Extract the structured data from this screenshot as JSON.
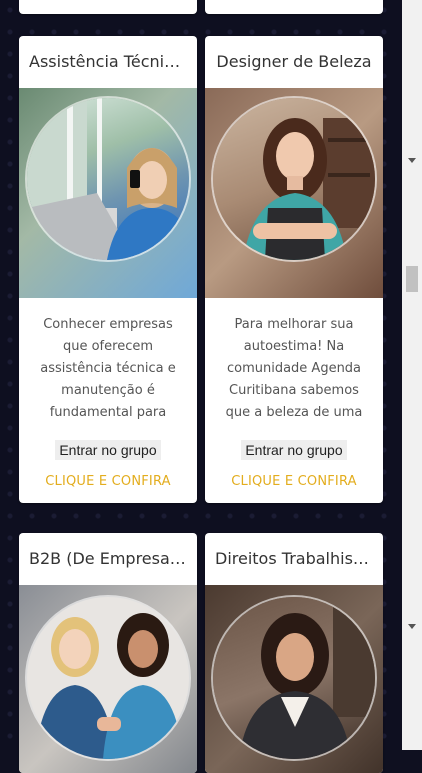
{
  "cards": [
    {
      "title": "Assistência Técnic...",
      "description": "Conhecer empresas que oferecem assistência técnica e manutenção é fundamental para",
      "join_label": "Entrar no grupo",
      "cta_label": "CLIQUE E CONFIRA",
      "image_alt": "woman-with-phone-and-laptop"
    },
    {
      "title": "Designer de Beleza",
      "description": "Para melhorar sua autoestima! Na comunidade Agenda Curitibana sabemos que a beleza de uma",
      "join_label": "Entrar no grupo",
      "cta_label": "CLIQUE E CONFIRA",
      "image_alt": "beauty-designer-woman"
    },
    {
      "title": "B2B (De Empresa ...",
      "image_alt": "two-businesswomen-fist-bump"
    },
    {
      "title": "Direitos Trabalhist...",
      "image_alt": "businesswoman-portrait"
    }
  ],
  "colors": {
    "cta": "#e3ad1e",
    "background": "#0e0f20",
    "card": "#ffffff"
  }
}
